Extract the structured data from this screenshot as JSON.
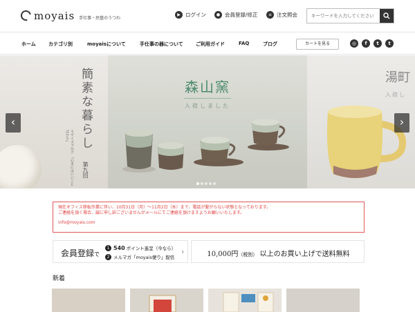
{
  "header": {
    "logo_text": "moyais",
    "logo_tagline": "手仕事・民藝のうつわ",
    "links": {
      "login": "ログイン",
      "register": "会員登録/修正",
      "order": "注文照会"
    },
    "search_placeholder": "キーワードを入力してください"
  },
  "nav": {
    "items": [
      "ホーム",
      "カテゴリ別",
      "moyaisについて",
      "手仕事の器について",
      "ご利用ガイド",
      "FAQ",
      "ブログ"
    ],
    "cart_label": "カートを見る",
    "social_icons": [
      "instagram-icon",
      "facebook-icon",
      "twitter-icon",
      "tumblr-icon"
    ]
  },
  "hero": {
    "left": {
      "title": "簡素な暮らし",
      "issue": "第九回",
      "sub": "モヤイズブログ 「心まにはいいことばかり」"
    },
    "center": {
      "title": "森山窯",
      "sub": "入荷しました"
    },
    "right": {
      "title": "湯町",
      "sub": "入荷し"
    },
    "dots": 5,
    "active_dot": 0
  },
  "notice": {
    "line1": "現在オフィス移転作業に伴い、10月31日（月）〜11月2日（水）まで、電話が繋がらない状態となっております。",
    "line2": "ご連絡を頂く場合、誠に申し訳ございませんがメールにてご連絡を頂けますようお願いいたします。",
    "email": "info@moyais.com"
  },
  "promo": {
    "member_main": "会員登録",
    "member_de": "で",
    "line1_num": "1",
    "line1_points": "540",
    "line1_text": "ポイント進呈（今なら）",
    "line2_num": "2",
    "line2_text": "メルマガ「moyais便り」配信",
    "shipping_amount": "10,000円",
    "shipping_tax": "（税別）",
    "shipping_text": "以上のお買い上げで送料無料"
  },
  "new_section_title": "新着",
  "colors": {
    "accent_green": "#4c8a6e",
    "notice_red": "#e04040",
    "dark": "#333333"
  }
}
